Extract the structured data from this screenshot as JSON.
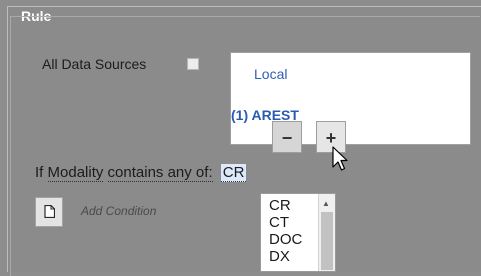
{
  "panel": {
    "legend": "Rule"
  },
  "sources": {
    "all_label": "All Data Sources",
    "items": [
      "Local",
      "(1) AREST"
    ]
  },
  "buttons": {
    "minus": "−",
    "plus": "+"
  },
  "rule": {
    "prefix": "If",
    "field": "Modality",
    "operator": "contains any of:",
    "value": "CR"
  },
  "add_condition": {
    "label": "Add Condition"
  },
  "dropdown": {
    "options": [
      "CR",
      "CT",
      "DOC",
      "DX"
    ]
  }
}
